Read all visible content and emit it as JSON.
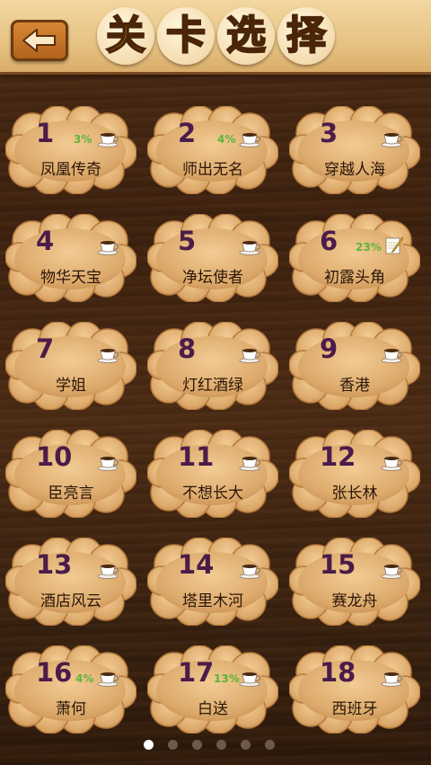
{
  "header": {
    "back_icon": "left-arrow-icon",
    "title_chars": [
      "关",
      "卡",
      "选",
      "择"
    ]
  },
  "levels": [
    {
      "number": "1",
      "name": "凤凰传奇",
      "percent": "3%",
      "icon": "coffee-cup-icon"
    },
    {
      "number": "2",
      "name": "师出无名",
      "percent": "4%",
      "icon": "coffee-cup-icon"
    },
    {
      "number": "3",
      "name": "穿越人海",
      "percent": "",
      "icon": "coffee-cup-icon"
    },
    {
      "number": "4",
      "name": "物华天宝",
      "percent": "",
      "icon": "coffee-cup-icon"
    },
    {
      "number": "5",
      "name": "净坛使者",
      "percent": "",
      "icon": "coffee-cup-icon"
    },
    {
      "number": "6",
      "name": "初露头角",
      "percent": "23%",
      "icon": "notepad-pencil-icon"
    },
    {
      "number": "7",
      "name": "学姐",
      "percent": "",
      "icon": "coffee-cup-icon"
    },
    {
      "number": "8",
      "name": "灯红酒绿",
      "percent": "",
      "icon": "coffee-cup-icon"
    },
    {
      "number": "9",
      "name": "香港",
      "percent": "",
      "icon": "coffee-cup-icon"
    },
    {
      "number": "10",
      "name": "臣亮言",
      "percent": "",
      "icon": "coffee-cup-icon"
    },
    {
      "number": "11",
      "name": "不想长大",
      "percent": "",
      "icon": "coffee-cup-icon"
    },
    {
      "number": "12",
      "name": "张长林",
      "percent": "",
      "icon": "coffee-cup-icon"
    },
    {
      "number": "13",
      "name": "酒店风云",
      "percent": "",
      "icon": "coffee-cup-icon"
    },
    {
      "number": "14",
      "name": "塔里木河",
      "percent": "",
      "icon": "coffee-cup-icon"
    },
    {
      "number": "15",
      "name": "赛龙舟",
      "percent": "",
      "icon": "coffee-cup-icon"
    },
    {
      "number": "16",
      "name": "萧何",
      "percent": "4%",
      "icon": "coffee-cup-icon"
    },
    {
      "number": "17",
      "name": "白送",
      "percent": "13%",
      "icon": "coffee-cup-icon"
    },
    {
      "number": "18",
      "name": "西班牙",
      "percent": "",
      "icon": "coffee-cup-icon"
    }
  ],
  "pagination": {
    "pages": 6,
    "current": 1
  },
  "colors": {
    "level_number": "#4b1c4a",
    "percent_text": "#5fb33a",
    "cloud_fill": "#d9a46a",
    "title_fill": "#e89a1c"
  }
}
